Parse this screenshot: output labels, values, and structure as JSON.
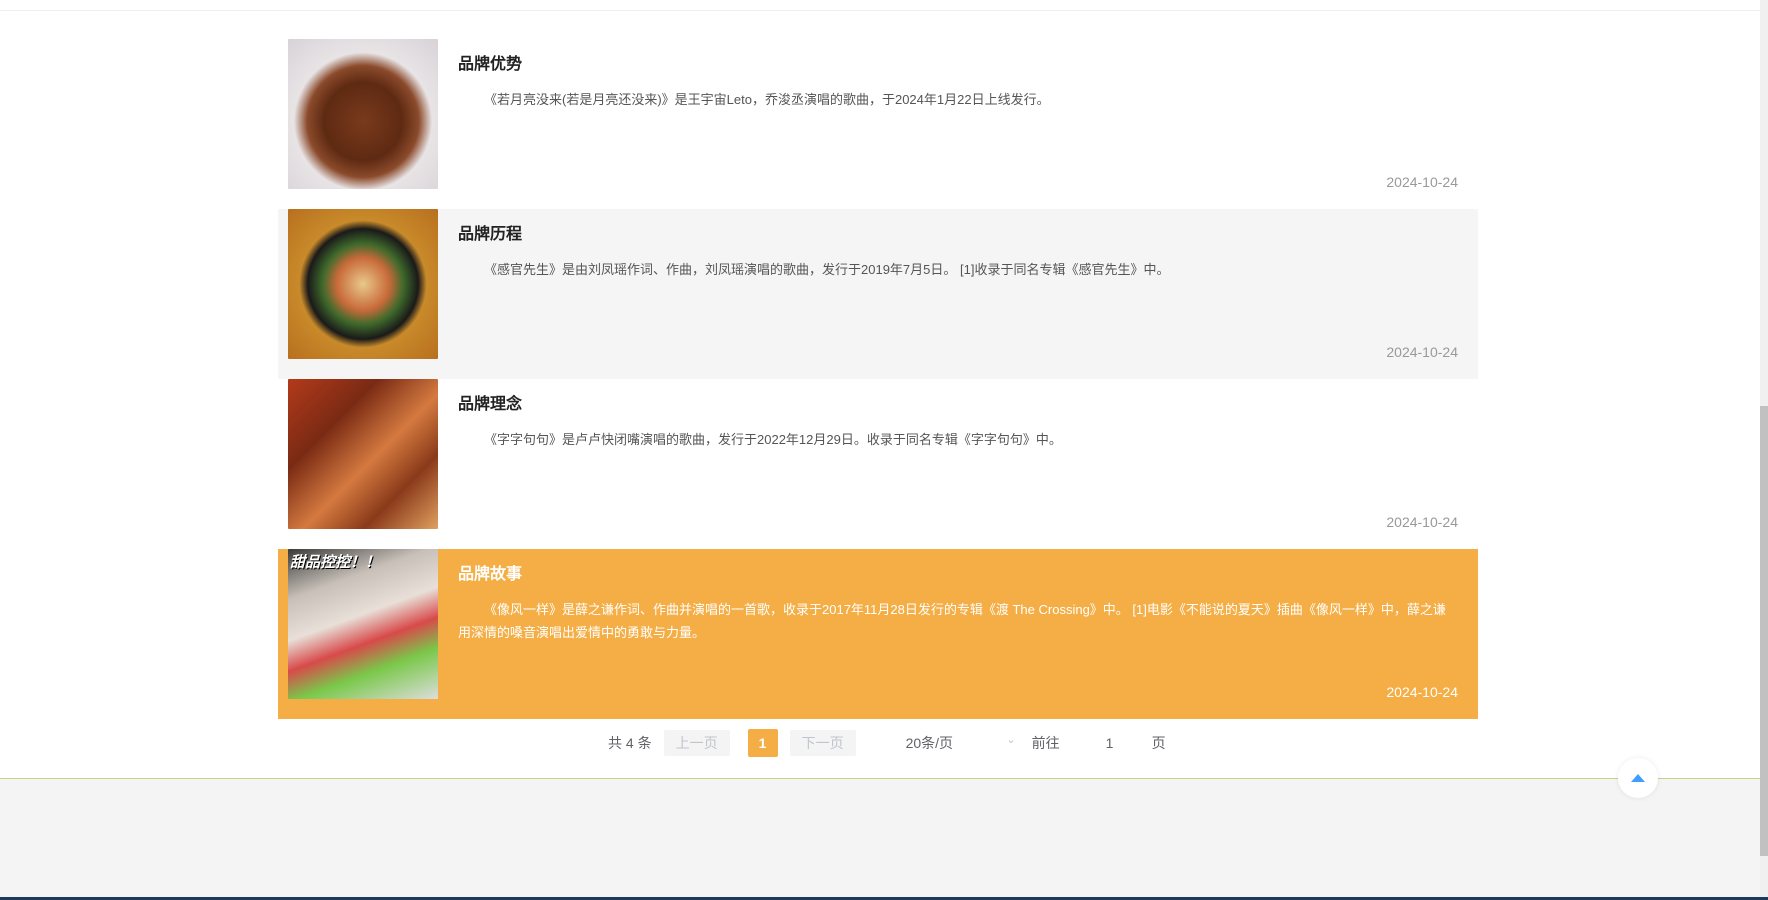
{
  "articles": [
    {
      "title": "品牌优势",
      "desc": "《若月亮没来(若是月亮还没来)》是王宇宙Leto，乔浚丞演唱的歌曲，于2024年1月22日上线发行。",
      "date": "2024-10-24"
    },
    {
      "title": "品牌历程",
      "desc": "《感官先生》是由刘凤瑶作词、作曲，刘凤瑶演唱的歌曲，发行于2019年7月5日。 [1]收录于同名专辑《感官先生》中。",
      "date": "2024-10-24"
    },
    {
      "title": "品牌理念",
      "desc": "《字字句句》是卢卢快闭嘴演唱的歌曲，发行于2022年12月29日。收录于同名专辑《字字句句》中。",
      "date": "2024-10-24"
    },
    {
      "title": "品牌故事",
      "desc": "《像风一样》是薛之谦作词、作曲并演唱的一首歌，收录于2017年11月28日发行的专辑《渡 The Crossing》中。 [1]电影《不能说的夏天》插曲《像风一样》中，薛之谦用深情的嗓音演唱出爱情中的勇敢与力量。",
      "date": "2024-10-24",
      "image_text": "甜品控控！！"
    }
  ],
  "pagination": {
    "total": "共 4 条",
    "prev": "上一页",
    "current": "1",
    "next": "下一页",
    "page_size": "20条/页",
    "goto": "前往",
    "goto_value": "1",
    "unit": "页"
  },
  "colors": {
    "accent": "#f4ae45",
    "back_to_top": "#409eff"
  }
}
